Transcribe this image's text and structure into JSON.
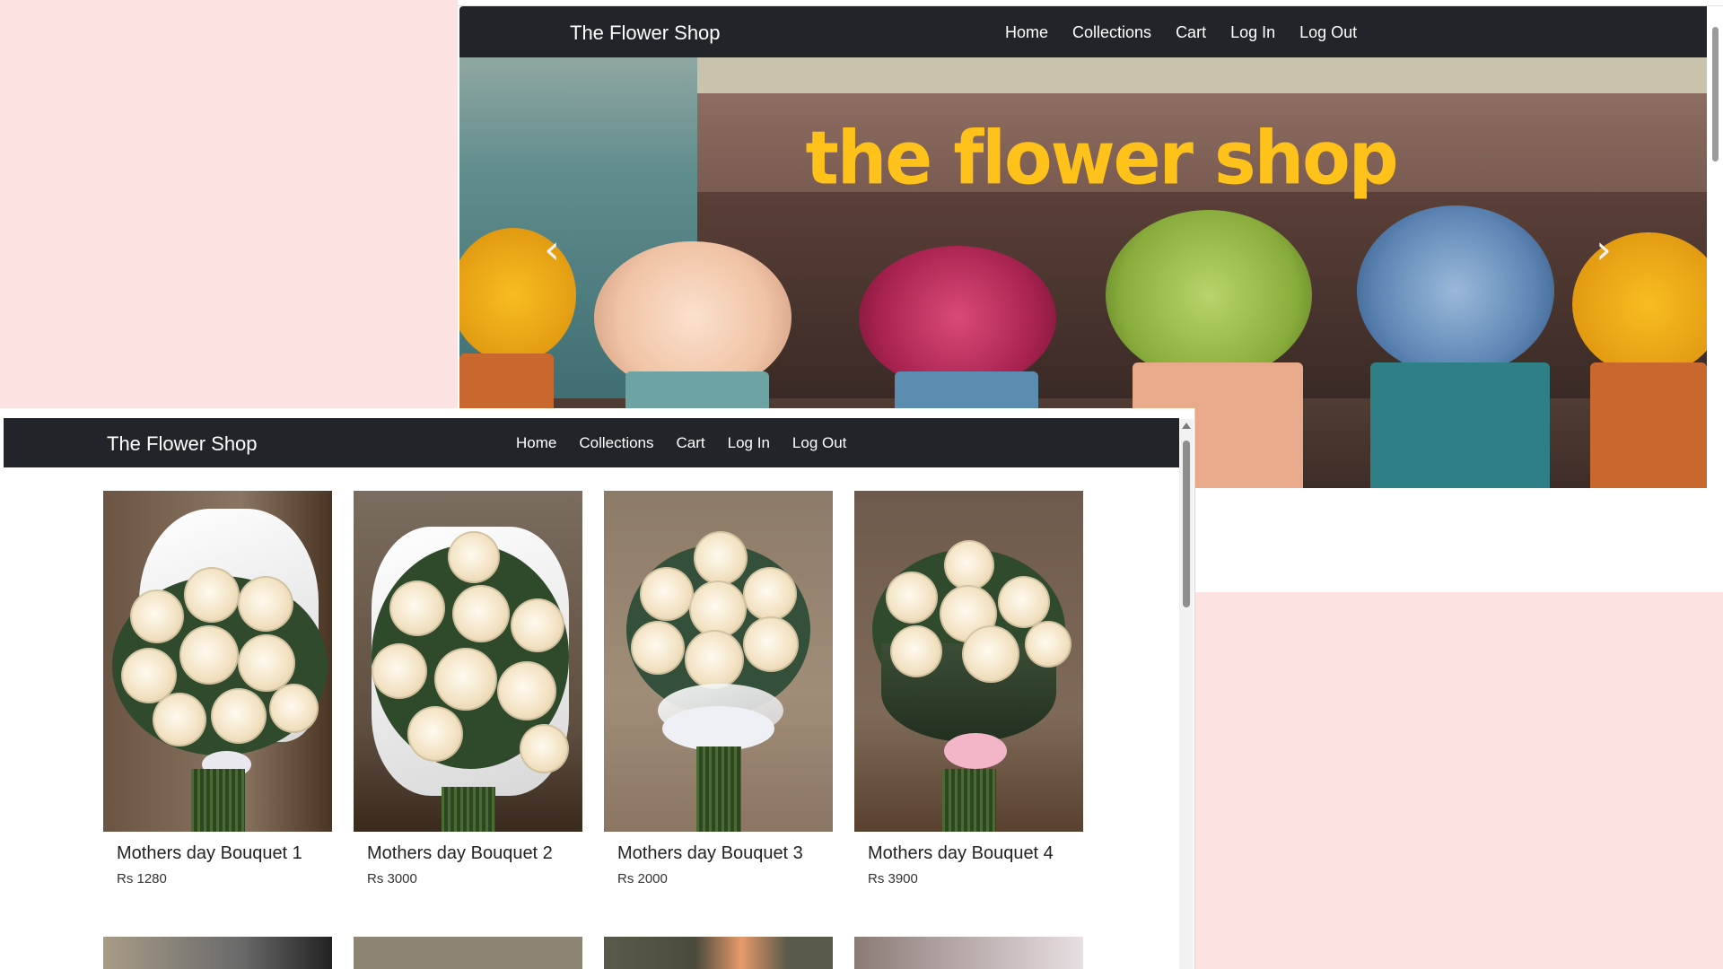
{
  "back_window": {
    "brand": "The Flower Shop",
    "nav": [
      "Home",
      "Collections",
      "Cart",
      "Log In",
      "Log Out"
    ],
    "hero": {
      "banner_text": "the flower shop",
      "prev_icon": "chevron-left-icon",
      "next_icon": "chevron-right-icon",
      "title_color": "#ffc21a"
    }
  },
  "front_window": {
    "brand": "The Flower Shop",
    "nav": [
      "Home",
      "Collections",
      "Cart",
      "Log In",
      "Log Out"
    ],
    "products": [
      {
        "name": "Mothers day Bouquet 1",
        "price": "Rs 1280"
      },
      {
        "name": "Mothers day Bouquet 2",
        "price": "Rs 3000"
      },
      {
        "name": "Mothers day Bouquet 3",
        "price": "Rs 2000"
      },
      {
        "name": "Mothers day Bouquet 4",
        "price": "Rs 3900"
      }
    ]
  },
  "colors": {
    "navbar": "#212529",
    "desktop": "#fde2e2"
  }
}
